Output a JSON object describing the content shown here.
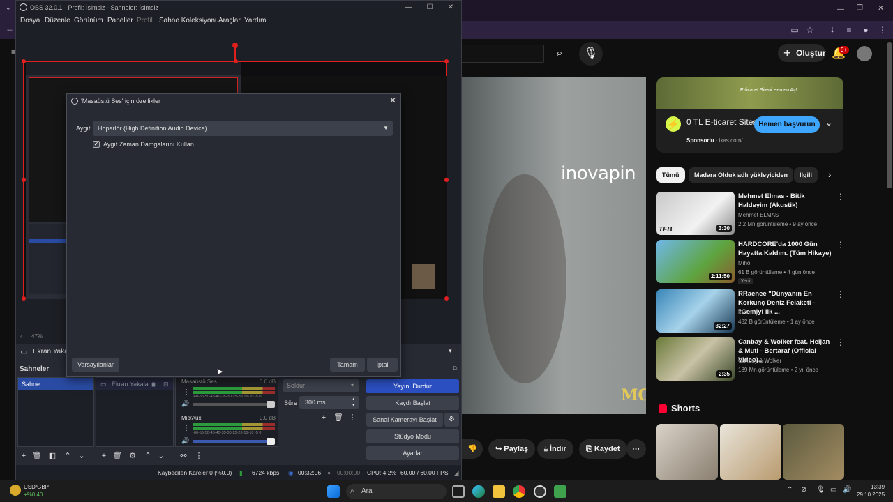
{
  "obs": {
    "title": "OBS 32.0.1 - Profil: İsimsiz - Sahneler: İsimsiz",
    "menu": [
      "Dosya",
      "Düzenle",
      "Görünüm",
      "Paneller",
      "Profil",
      "Sahne Koleksiyonu",
      "Araçlar",
      "Yardım"
    ],
    "preview_zoom": "47%",
    "source_bar_label": "Ekran Yakala",
    "scenes_header": "Sahneler",
    "scene_item": "Sahne",
    "source_item": "Ekran Yakala",
    "mixer": {
      "ch1_name": "Masaüstü Ses",
      "ch1_db": "0.0 dB",
      "ch2_name": "Mic/Aux",
      "ch2_db": "0.0 dB",
      "ch1_level": 0.5,
      "ch2_level": 0.35,
      "scale": "-60-55-50-45-40-35-30-25-20-15-10 -5 0"
    },
    "transition": {
      "type": "Soldur",
      "duration_label": "Süre",
      "duration": "300 ms"
    },
    "controls": [
      "Yayını Durdur",
      "Kaydı Başlat",
      "Sanal Kamerayı Başlat",
      "Stüdyo Modu",
      "Ayarlar"
    ],
    "status": {
      "dropped": "Kaybedilen Kareler 0 (%0.0)",
      "bitrate": "6724 kbps",
      "stream_time": "00:32:06",
      "rec_time": "00:00:00",
      "cpu": "CPU: 4.2%",
      "fps": "60.00 / 60.00 FPS"
    }
  },
  "dialog": {
    "title": "'Masaüstü Ses' için özellikler",
    "device_label": "Aygıt",
    "device_value": "Hoparlör (High Definition Audio Device)",
    "checkbox_label": "Aygıt Zaman Damgalarını Kullan",
    "checkbox_checked": true,
    "defaults_button": "Varsayılanlar",
    "ok_button": "Tamam",
    "cancel_button": "İptal"
  },
  "youtube": {
    "create": "Oluştur",
    "notif_badge": "9+",
    "video_brand": "inovapin",
    "video_watermark": "MO",
    "actions": [
      "Paylaş",
      "İndir",
      "Kaydet"
    ],
    "ad": {
      "banner": "E-ticaret Siteni Hemen Aç!",
      "title": "0 TL E-ticaret Sitesi",
      "sponsor": "Sponsorlu",
      "domain": "ikas.com/...",
      "cta": "Hemen başvurun"
    },
    "chips": [
      "Tümü",
      "Madara Olduk adlı yükleyiciden",
      "İlgili"
    ],
    "videos": [
      {
        "title": "Mehmet Elmas - Bitik Haldeyim (Akustik)",
        "channel": "Mehmet ELMAS",
        "meta": "2,2 Mn görüntüleme • 9 ay önce",
        "duration": "3:30",
        "badge": ""
      },
      {
        "title": "HARDCORE'da 1000 Gün Hayatta Kaldım. (Tüm Hikaye)",
        "channel": "Miho",
        "meta": "61 B görüntüleme • 4 gün önce",
        "duration": "2:11:50",
        "badge": "Yeni"
      },
      {
        "title": "RRaenee \"Dünyanın En Korkunç Deniz Felaketi - \"Gemiyi ilk ...",
        "channel": "Kickoloji",
        "meta": "482 B görüntüleme • 1 ay önce",
        "duration": "32:27",
        "badge": ""
      },
      {
        "title": "Canbay & Wolker feat. Heijan & Muti - Bertaraf (Official Video)...",
        "channel": "Canbay & Wolker",
        "meta": "189 Mn görüntüleme • 2 yıl önce",
        "duration": "2:35",
        "badge": ""
      }
    ],
    "shorts_title": "Shorts"
  },
  "taskbar": {
    "ticker_name": "USD/GBP",
    "ticker_change": "+%0,40",
    "search_placeholder": "Ara",
    "time": "13:39",
    "date": "29.10.2025"
  },
  "colors": {
    "obs_bg": "#272a33",
    "obs_accent": "#2b4fc0",
    "yt_bg": "#0f0f0f",
    "yt_cta": "#3ea6ff",
    "red": "#e01f1f"
  }
}
